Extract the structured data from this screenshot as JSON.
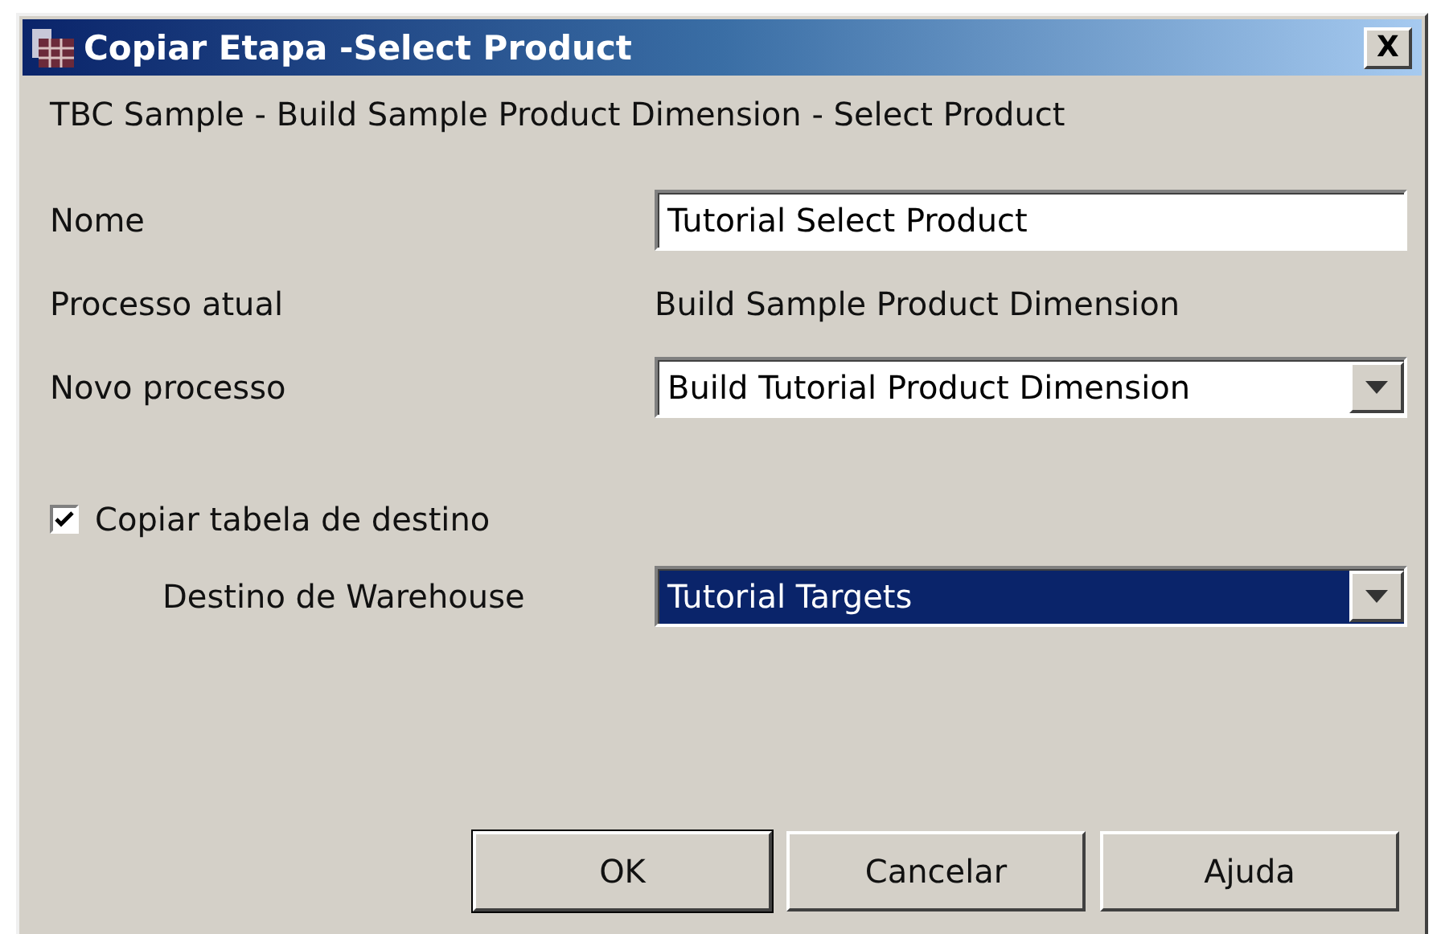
{
  "window": {
    "title": "Copiar Etapa -Select Product",
    "close": "X"
  },
  "subtitle": "TBC Sample - Build Sample Product Dimension - Select Product",
  "fields": [
    {
      "kind": "input",
      "label": "Nome",
      "value": "Tutorial Select Product"
    },
    {
      "kind": "text",
      "label": "Processo atual",
      "value": "Build Sample Product Dimension"
    },
    {
      "kind": "combo",
      "label": "Novo processo",
      "value": "Build Tutorial Product Dimension",
      "selected": false
    }
  ],
  "copy_table": {
    "label": "Copiar tabela de destino",
    "checked": true
  },
  "warehouse": {
    "label": "Destino de Warehouse",
    "value": "Tutorial Targets",
    "selected": true
  },
  "buttons": [
    {
      "label": "OK",
      "default": true
    },
    {
      "label": "Cancelar",
      "default": false
    },
    {
      "label": "Ajuda",
      "default": false
    }
  ]
}
